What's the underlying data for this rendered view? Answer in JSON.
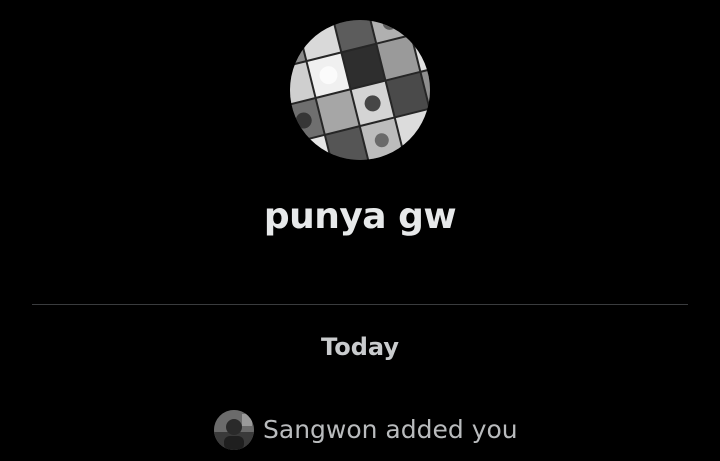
{
  "conversation": {
    "name": "punya gw",
    "avatar_icon": "group-photo-collage"
  },
  "timeline": {
    "day_label": "Today",
    "events": [
      {
        "avatar_icon": "user-avatar-photo",
        "text": "Sangwon added you"
      }
    ]
  },
  "colors": {
    "background": "#000000",
    "primary_text": "#e7e9ea",
    "secondary_text": "#b9bbbd",
    "divider": "#3a3c3e"
  }
}
